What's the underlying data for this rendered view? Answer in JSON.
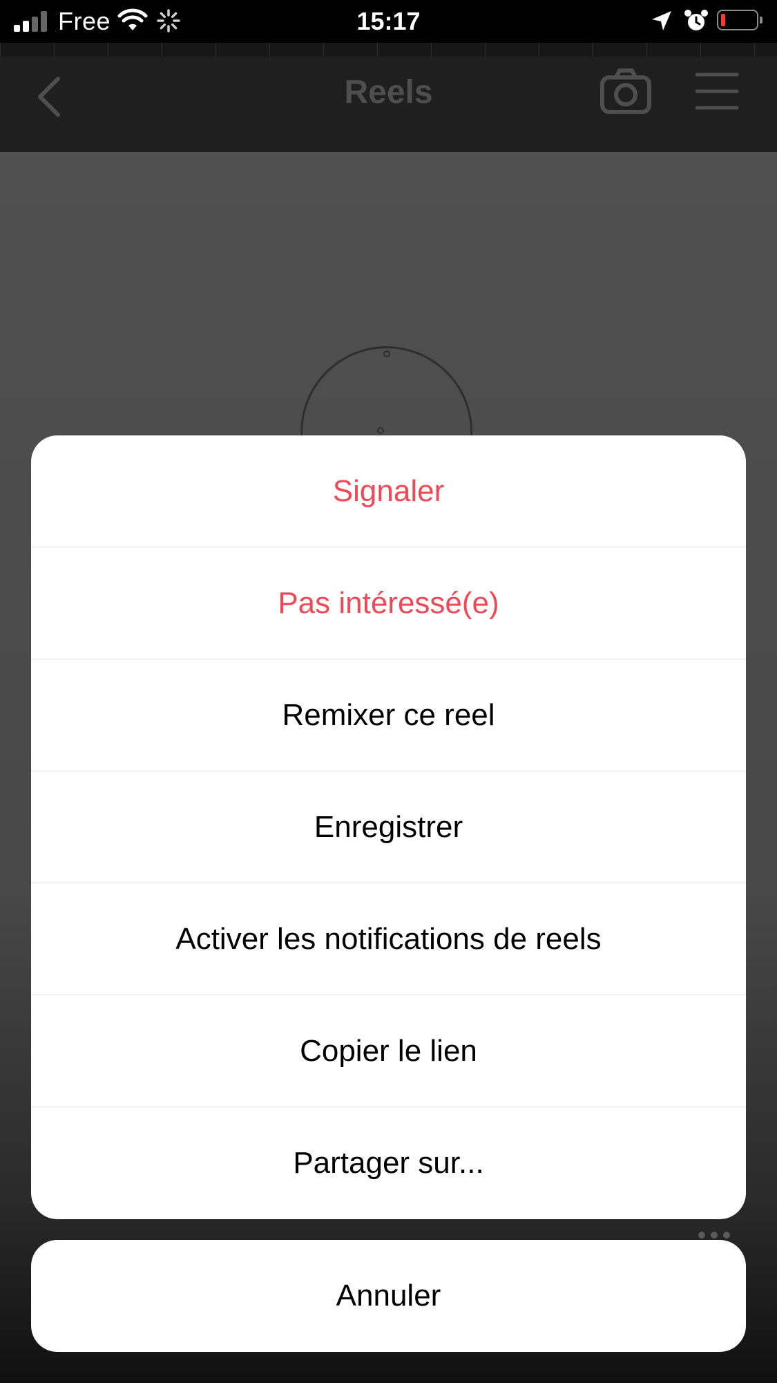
{
  "status_bar": {
    "carrier": "Free",
    "time": "15:17"
  },
  "header": {
    "title": "Reels",
    "back_icon": "chevron-left-icon",
    "camera_icon": "camera-icon",
    "menu_icon": "hamburger-menu-icon"
  },
  "colors": {
    "destructive": "#ed4956",
    "sheet_background": "#ffffff",
    "overlay": "#505050"
  },
  "action_sheet": {
    "items": [
      {
        "label": "Signaler",
        "style": "destructive"
      },
      {
        "label": "Pas intéressé(e)",
        "style": "destructive"
      },
      {
        "label": "Remixer ce reel",
        "style": "default"
      },
      {
        "label": "Enregistrer",
        "style": "default"
      },
      {
        "label": "Activer les notifications de reels",
        "style": "default"
      },
      {
        "label": "Copier le lien",
        "style": "default"
      },
      {
        "label": "Partager sur...",
        "style": "default"
      }
    ],
    "cancel_label": "Annuler"
  }
}
